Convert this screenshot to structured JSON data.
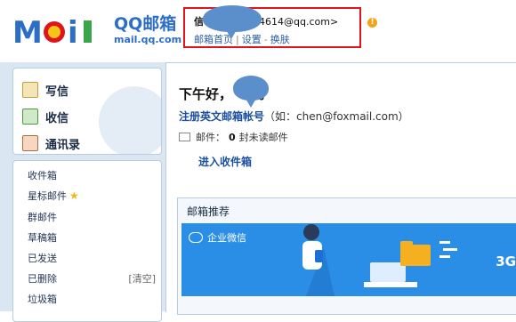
{
  "brand": {
    "logo_text": "MOil",
    "name": "QQ邮箱",
    "domain": "mail.qq.com"
  },
  "user": {
    "name_prefix": "信",
    "email_suffix": "4614@qq.com>",
    "home_link": "邮箱首页",
    "separator": "|",
    "settings_link": "设置",
    "dash": "-",
    "skin_link": "换肤",
    "warning_icon": "exclamation-icon"
  },
  "sidebar": {
    "compose": [
      {
        "label": "写信",
        "icon": "pen-icon"
      },
      {
        "label": "收信",
        "icon": "inbox-download-icon"
      },
      {
        "label": "通讯录",
        "icon": "address-book-icon"
      }
    ],
    "folders": [
      {
        "label": "收件箱"
      },
      {
        "label": "星标邮件",
        "icon": "star-icon"
      },
      {
        "label": "群邮件"
      },
      {
        "label": "草稿箱"
      },
      {
        "label": "已发送"
      },
      {
        "label": "已删除",
        "action": "[清空]"
      },
      {
        "label": "垃圾箱"
      }
    ]
  },
  "main": {
    "greeting_text": "下午好，",
    "greeting_tail": "。",
    "register_link": "注册英文邮箱帐号",
    "register_hint": "（如：chen@foxmail.com）",
    "mail_label": "邮件：",
    "unread_count": "0",
    "unread_label": "封未读邮件",
    "inbox_link": "进入收件箱",
    "recommend_title": "邮箱推荐",
    "banner_label": "企业微信",
    "banner_tail": "3G"
  },
  "colors": {
    "brand_blue": "#2c6dc6",
    "highlight_red": "#e0141c",
    "sidebar_bg": "#dbe6f3",
    "banner_blue": "#2b8ee6"
  }
}
